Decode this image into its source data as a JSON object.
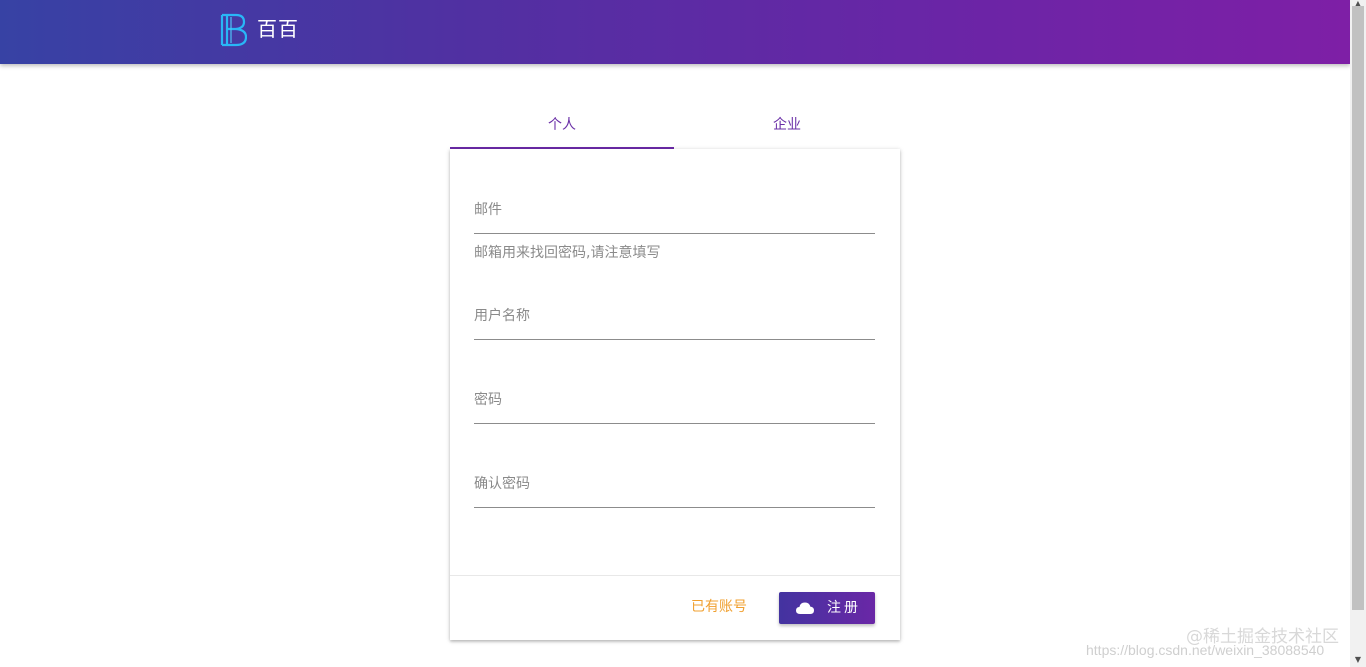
{
  "header": {
    "logo_icon": "b-logo-icon",
    "brand": "百百",
    "gradient_start": "#3742a4",
    "gradient_end": "#7e1fa6"
  },
  "tabs": [
    {
      "label": "个人",
      "active": true
    },
    {
      "label": "企业",
      "active": false
    }
  ],
  "form": {
    "email_label": "邮件",
    "email_hint": "邮箱用来找回密码,请注意填写",
    "username_label": "用户名称",
    "password_label": "密码",
    "confirm_password_label": "确认密码"
  },
  "actions": {
    "login_link": "已有账号",
    "register_icon": "cloud-icon",
    "register_label": "注册"
  },
  "watermark": {
    "url": "https://blog.csdn.net/weixin_38088540",
    "site": "@稀土掘金技术社区"
  },
  "colors": {
    "accent": "#6b2aa8",
    "link": "#f0a030"
  }
}
